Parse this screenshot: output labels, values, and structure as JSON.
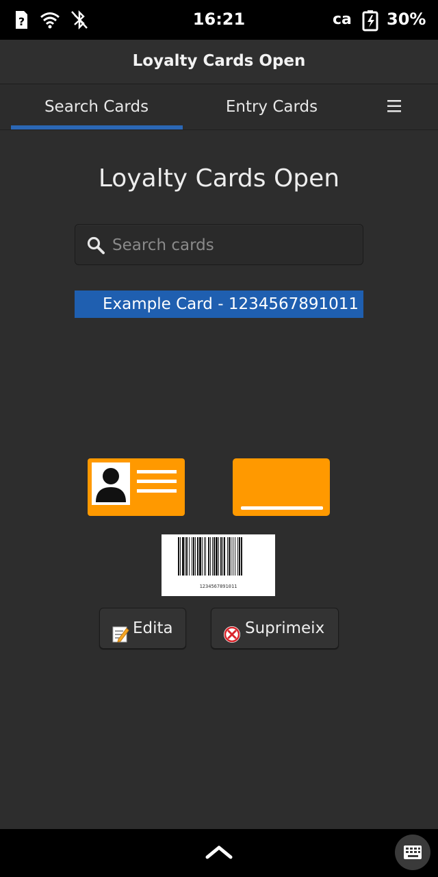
{
  "status_bar": {
    "time": "16:21",
    "language": "ca",
    "battery": "30%",
    "icons": [
      "sim-unknown-icon",
      "wifi-icon",
      "bluetooth-off-icon",
      "battery-charging-icon"
    ]
  },
  "app": {
    "window_title": "Loyalty Cards Open",
    "tabs": [
      {
        "label": "Search Cards",
        "active": true
      },
      {
        "label": "Entry Cards",
        "active": false
      }
    ],
    "menu_icon": "hamburger-icon"
  },
  "main": {
    "title": "Loyalty Cards Open",
    "search": {
      "placeholder": "Search cards",
      "value": ""
    },
    "cards": [
      {
        "label": "Example Card - 1234567891011",
        "selected": true
      }
    ],
    "barcode_number": "1234567891011",
    "images": [
      "card-holder-image",
      "card-front-image",
      "barcode-image"
    ],
    "buttons": {
      "edit": {
        "icon": "📝",
        "label": "Edita"
      },
      "delete": {
        "icon": "❌",
        "label": "Suprimeix"
      }
    }
  },
  "bottom_bar": {
    "icons": [
      "chevron-up-icon",
      "keyboard-icon"
    ]
  },
  "colors": {
    "accent": "#2b67b5",
    "selection": "#1f5fb0",
    "card_orange": "#ff9900",
    "background": "#2d2d2d"
  }
}
